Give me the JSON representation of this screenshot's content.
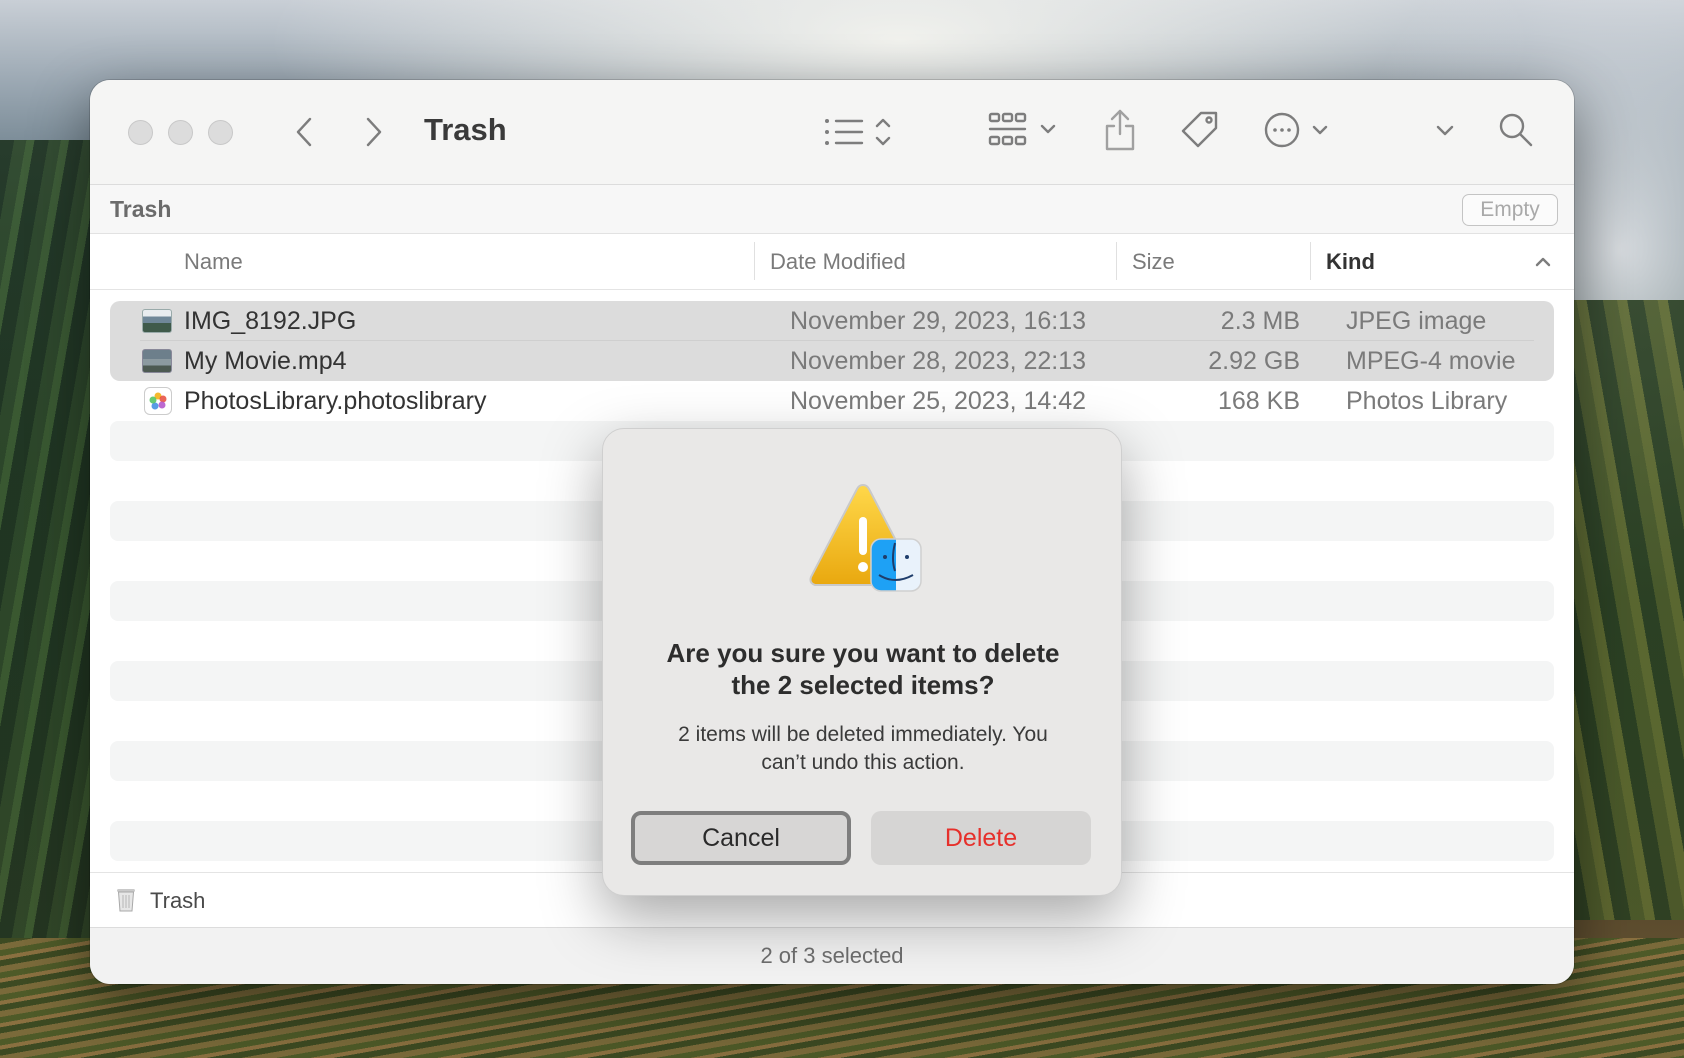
{
  "window": {
    "title": "Trash",
    "pathbar_label": "Trash",
    "empty_label": "Empty"
  },
  "columns": {
    "name": "Name",
    "date": "Date Modified",
    "size": "Size",
    "kind": "Kind"
  },
  "files": [
    {
      "name": "IMG_8192.JPG",
      "date": "November 29, 2023, 16:13",
      "size": "2.3 MB",
      "kind": "JPEG image",
      "selected": true
    },
    {
      "name": "My Movie.mp4",
      "date": "November 28, 2023, 22:13",
      "size": "2.92 GB",
      "kind": "MPEG-4 movie",
      "selected": true
    },
    {
      "name": "PhotosLibrary.photoslibrary",
      "date": "November 25, 2023, 14:42",
      "size": "168 KB",
      "kind": "Photos Library",
      "selected": false
    }
  ],
  "footer": {
    "path_label": "Trash",
    "status": "2 of 3 selected"
  },
  "dialog": {
    "title_line1": "Are you sure you want to delete",
    "title_line2": "the 2 selected items?",
    "message_line1": "2 items will be deleted immediately. You",
    "message_line2": "can’t undo this action.",
    "cancel_label": "Cancel",
    "delete_label": "Delete",
    "delete_color": "#e6302b"
  }
}
